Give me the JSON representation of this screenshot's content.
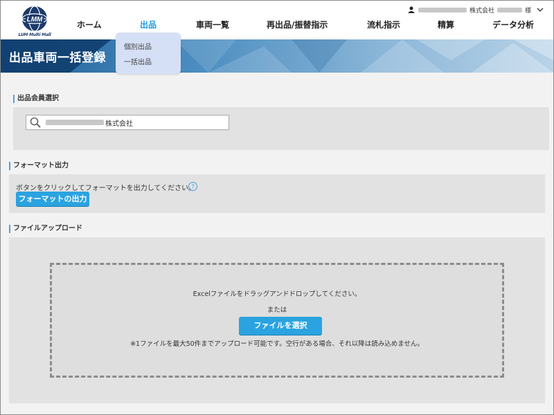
{
  "header": {
    "logo_text": "LMM",
    "logo_caption": "LUM Multi Mall",
    "user": {
      "company_suffix": "株式会社",
      "name_suffix": "様"
    }
  },
  "nav": {
    "items": [
      {
        "label": "ホーム"
      },
      {
        "label": "出品"
      },
      {
        "label": "車両一覧"
      },
      {
        "label": "再出品/振替指示"
      },
      {
        "label": "流札指示"
      },
      {
        "label": "精算"
      },
      {
        "label": "データ分析"
      }
    ],
    "dropdown": [
      {
        "label": "個別出品"
      },
      {
        "label": "一括出品"
      }
    ]
  },
  "banner": {
    "title": "出品車両一括登録"
  },
  "member_section": {
    "heading": "出品会員選択",
    "value_suffix": "株式会社"
  },
  "format_section": {
    "heading": "フォーマット出力",
    "instruction": "ボタンをクリックしてフォーマットを出力してください。",
    "help": "?",
    "button_label": "フォーマットの出力"
  },
  "upload_section": {
    "heading": "ファイルアップロード",
    "drop_text": "Excelファイルをドラッグアンドドロップしてください。",
    "or_text": "または",
    "button_label": "ファイルを選択",
    "note": "※1ファイルを最大50件までアップロード可能です。空行がある場合、それ以降は読み込めません。"
  },
  "colors": {
    "accent": "#1e9be0",
    "button": "#2aa3e0",
    "dropdown_bg": "#d5dff5",
    "banner_dark": "#1f5f98"
  },
  "icons": [
    "person-icon",
    "chevron-down-icon",
    "search-icon",
    "help-icon",
    "logo-globe-icon"
  ]
}
